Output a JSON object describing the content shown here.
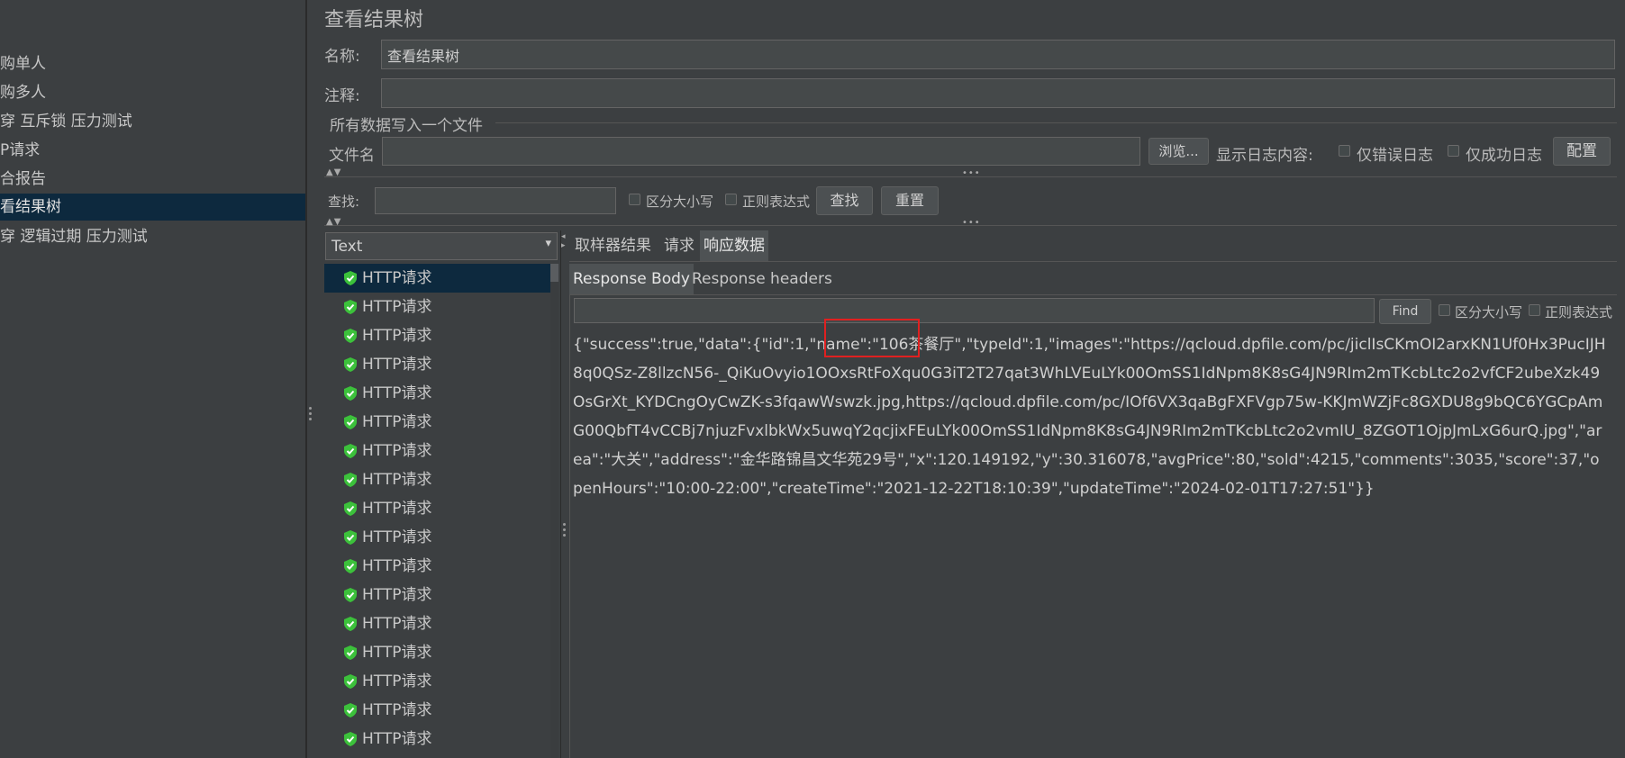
{
  "tree": {
    "items": [
      {
        "label": "购单人"
      },
      {
        "label": "购多人"
      },
      {
        "label": "穿 互斥锁 压力测试"
      },
      {
        "label": "P请求"
      },
      {
        "label": "合报告"
      },
      {
        "label": "看结果树"
      },
      {
        "label": "穿 逻辑过期 压力测试"
      }
    ],
    "selected_index": 5
  },
  "panel": {
    "title": "查看结果树",
    "name_label": "名称:",
    "name_value": "查看结果树",
    "comment_label": "注释:",
    "comment_value": "",
    "file_section_title": "所有数据写入一个文件",
    "filename_label": "文件名",
    "filename_value": "",
    "browse_label": "浏览...",
    "log_display_label": "显示日志内容:",
    "errors_only_label": "仅错误日志",
    "success_only_label": "仅成功日志",
    "config_label": "配置"
  },
  "search": {
    "label": "查找:",
    "value": "",
    "case_label": "区分大小写",
    "regex_label": "正则表达式",
    "find_label": "查找",
    "reset_label": "重置"
  },
  "renderer": {
    "selected": "Text"
  },
  "samples": {
    "items": [
      "HTTP请求",
      "HTTP请求",
      "HTTP请求",
      "HTTP请求",
      "HTTP请求",
      "HTTP请求",
      "HTTP请求",
      "HTTP请求",
      "HTTP请求",
      "HTTP请求",
      "HTTP请求",
      "HTTP请求",
      "HTTP请求",
      "HTTP请求",
      "HTTP请求",
      "HTTP请求",
      "HTTP请求"
    ],
    "status_icon": "green-shield-check-icon",
    "selected_index": 0
  },
  "result_tabs": [
    "取样器结果",
    "请求",
    "响应数据"
  ],
  "result_active_tab": 2,
  "response_tabs": [
    "Response Body",
    "Response headers"
  ],
  "response_active_tab": 0,
  "response_search": {
    "value": "",
    "find_label": "Find",
    "case_label": "区分大小写",
    "regex_label": "正则表达式"
  },
  "response_body": "{\"success\":true,\"data\":{\"id\":1,\"name\":\"106茶餐厅\",\"typeId\":1,\"images\":\"https://qcloud.dpfile.com/pc/jiclIsCKmOI2arxKN1Uf0Hx3PucIJH8q0QSz-Z8llzcN56-_QiKuOvyio1OOxsRtFoXqu0G3iT2T27qat3WhLVEuLYk00OmSS1IdNpm8K8sG4JN9RIm2mTKcbLtc2o2vfCF2ubeXzk49OsGrXt_KYDCngOyCwZK-s3fqawWswzk.jpg,https://qcloud.dpfile.com/pc/IOf6VX3qaBgFXFVgp75w-KKJmWZjFc8GXDU8g9bQC6YGCpAmG00QbfT4vCCBj7njuzFvxlbkWx5uwqY2qcjixFEuLYk00OmSS1IdNpm8K8sG4JN9RIm2mTKcbLtc2o2vmIU_8ZGOT1OjpJmLxG6urQ.jpg\",\"area\":\"大关\",\"address\":\"金华路锦昌文华苑29号\",\"x\":120.149192,\"y\":30.316078,\"avgPrice\":80,\"sold\":4215,\"comments\":3035,\"score\":37,\"openHours\":\"10:00-22:00\",\"createTime\":\"2021-12-22T18:10:39\",\"updateTime\":\"2024-02-01T17:27:51\"}}",
  "colors": {
    "background": "#3c3f41",
    "selection": "#0d293e",
    "highlight_box": "#e02020",
    "status_ok": "#3cc13b"
  }
}
